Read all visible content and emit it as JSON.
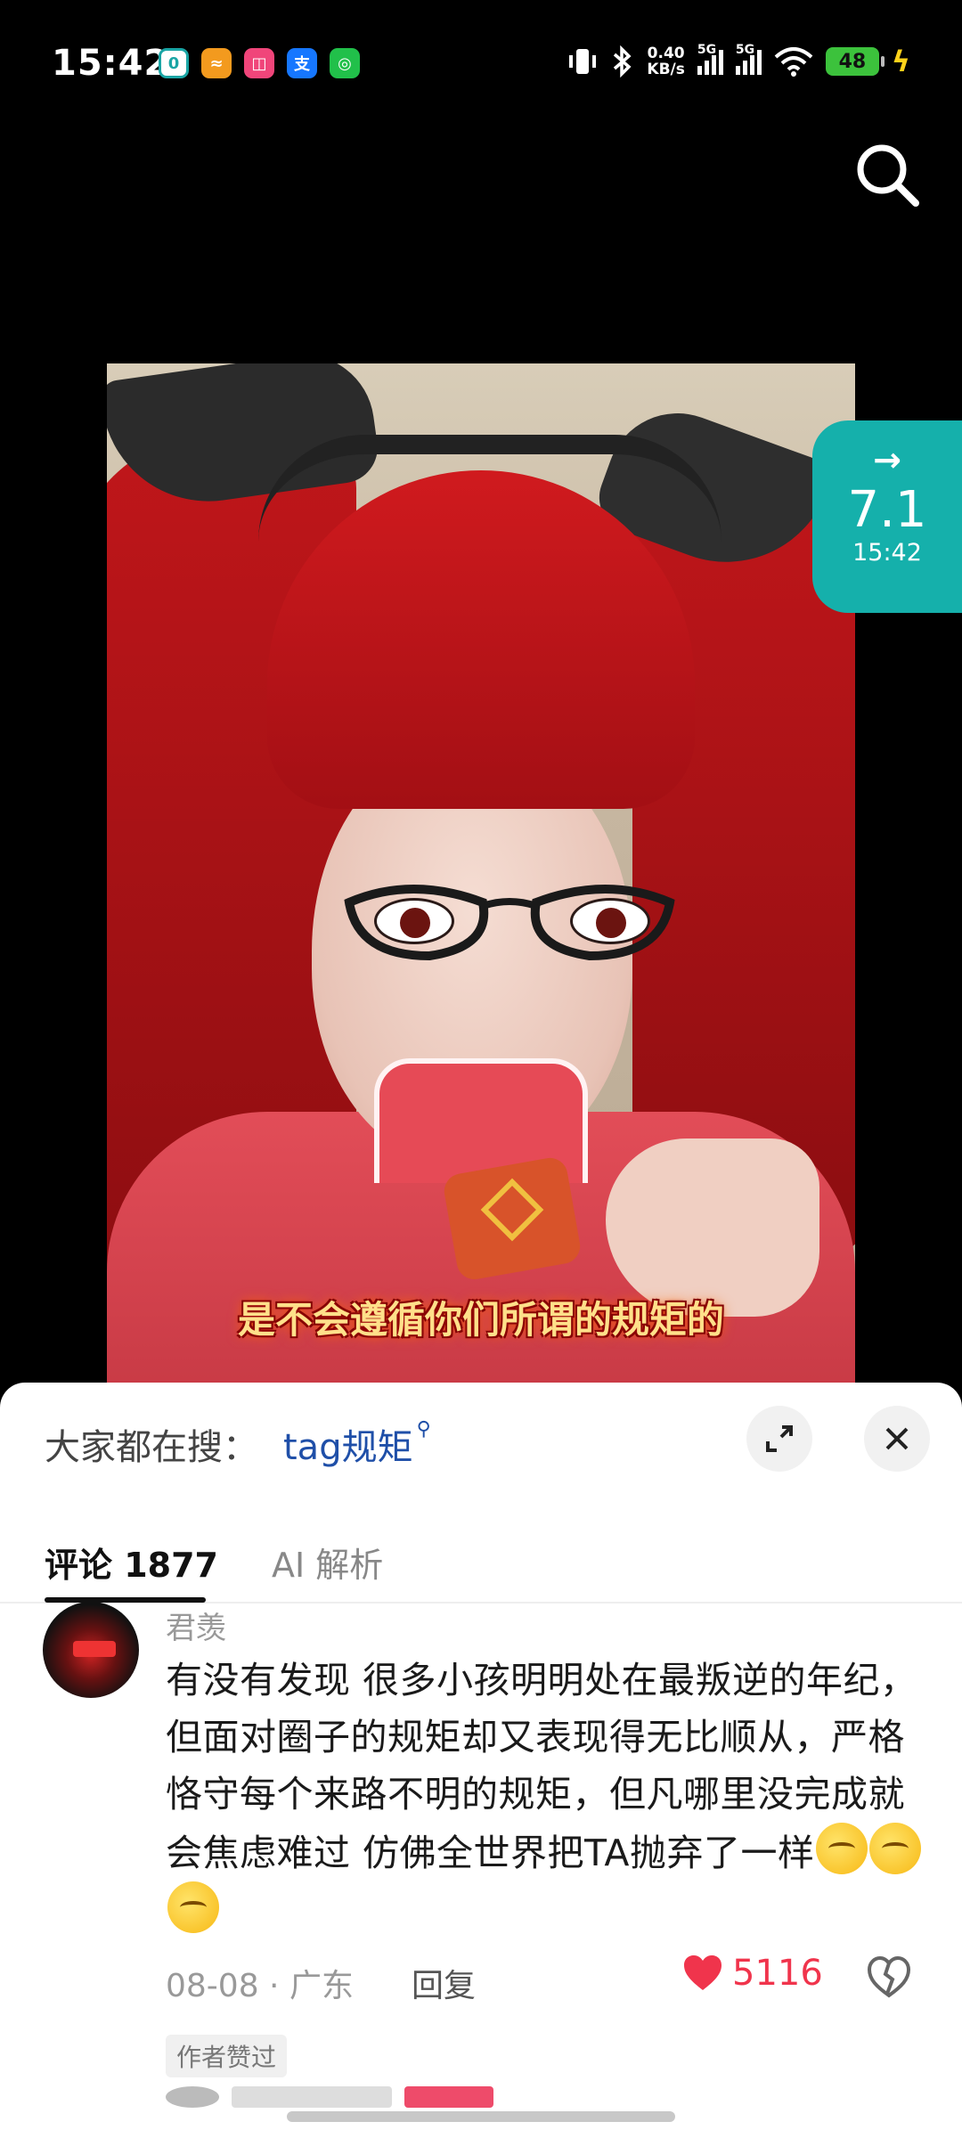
{
  "status_bar": {
    "time": "15:42",
    "app_icons": [
      "green-square-app",
      "orange-app",
      "pink-app",
      "alipay",
      "wechat"
    ],
    "net_speed_value": "0.40",
    "net_speed_unit": "KB/s",
    "sim1": "5G",
    "sim2": "5G",
    "battery": "48"
  },
  "share_pill": {
    "arrow": "→",
    "version": "7.1",
    "time": "15:42"
  },
  "video": {
    "caption": "是不会遵循你们所谓的规矩的"
  },
  "comments_panel": {
    "hot_search_label": "大家都在搜：",
    "hot_search_term": "tag规矩",
    "tabs": [
      {
        "label": "评论 1877",
        "active": true
      },
      {
        "label": "AI 解析",
        "active": false
      }
    ],
    "comment": {
      "username": "君羡",
      "text": "有没有发现 很多小孩明明处在最叛逆的年纪，但面对圈子的规矩却又表现得无比顺从，严格恪守每个来路不明的规矩，但凡哪里没完成就会焦虑难过 仿佛全世界把TA抛弃了一样",
      "emoji_count": 3,
      "meta": "08-08 · 广东",
      "reply_label": "回复",
      "likes": "5116",
      "author_tag": "作者赞过"
    }
  },
  "colors": {
    "accent_teal": "#15b0ab",
    "like_red": "#f0344c",
    "link_blue": "#1f4fa8"
  }
}
